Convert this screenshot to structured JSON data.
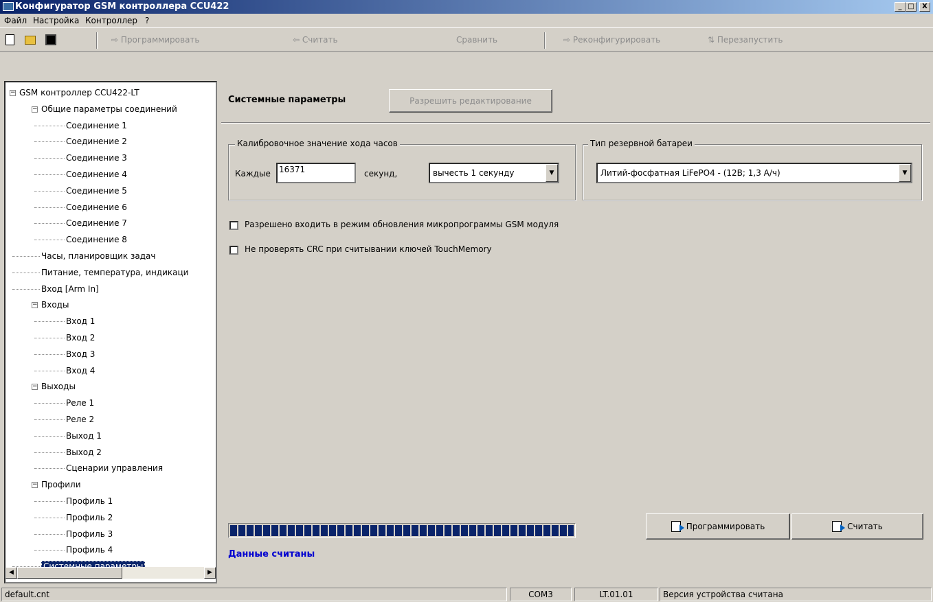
{
  "window": {
    "title": "Конфигуратор GSM контроллера CCU422",
    "icon": "app-icon",
    "minimize": "_",
    "maximize": "□",
    "close": "X"
  },
  "menu": [
    "Файл",
    "Настройка",
    "Контроллер",
    "?"
  ],
  "toolbar": {
    "program": "Программировать",
    "read": "Считать",
    "compare": "Сравнить",
    "reconfigure": "Реконфигурировать",
    "restart": "Перезапустить"
  },
  "tree": [
    {
      "label": "GSM контроллер CCU422-LT",
      "level": 0,
      "expanded": true
    },
    {
      "label": "Общие параметры соединений",
      "level": 1,
      "expanded": true
    },
    {
      "label": "Соединение 1",
      "level": 2
    },
    {
      "label": "Соединение 2",
      "level": 2
    },
    {
      "label": "Соединение 3",
      "level": 2
    },
    {
      "label": "Соединение 4",
      "level": 2
    },
    {
      "label": "Соединение 5",
      "level": 2
    },
    {
      "label": "Соединение 6",
      "level": 2
    },
    {
      "label": "Соединение 7",
      "level": 2
    },
    {
      "label": "Соединение 8",
      "level": 2
    },
    {
      "label": "Часы, планировщик задач",
      "level": 1
    },
    {
      "label": "Питание, температура, индикаци",
      "level": 1
    },
    {
      "label": "Вход [Arm In]",
      "level": 1
    },
    {
      "label": "Входы",
      "level": 1,
      "expanded": true
    },
    {
      "label": "Вход 1",
      "level": 2
    },
    {
      "label": "Вход 2",
      "level": 2
    },
    {
      "label": "Вход 3",
      "level": 2
    },
    {
      "label": "Вход 4",
      "level": 2
    },
    {
      "label": "Выходы",
      "level": 1,
      "expanded": true
    },
    {
      "label": "Реле 1",
      "level": 2
    },
    {
      "label": "Реле 2",
      "level": 2
    },
    {
      "label": "Выход 1",
      "level": 2
    },
    {
      "label": "Выход 2",
      "level": 2
    },
    {
      "label": "Сценарии управления",
      "level": 2
    },
    {
      "label": "Профили",
      "level": 1,
      "expanded": true
    },
    {
      "label": "Профиль 1",
      "level": 2
    },
    {
      "label": "Профиль 2",
      "level": 2
    },
    {
      "label": "Профиль 3",
      "level": 2
    },
    {
      "label": "Профиль 4",
      "level": 2
    },
    {
      "label": "Системные параметры",
      "level": 1,
      "selected": true
    }
  ],
  "panel": {
    "title": "Системные параметры",
    "enable_edit": "Разрешить редактирование",
    "clock_group": {
      "title": "Калибровочное значение хода часов",
      "every_label": "Каждые",
      "value": "16371",
      "unit_label": "секунд,",
      "action": "вычесть 1 секунду"
    },
    "battery_group": {
      "title": "Тип резервной батареи",
      "value": "Литий-фосфатная LiFePO4 - (12В; 1,3 А/ч)"
    },
    "check_fw_update": {
      "label": "Разрешено входить в режим обновления микропрограммы GSM модуля",
      "checked": false
    },
    "check_crc": {
      "label": "Не проверять CRC при считывании ключей TouchMemory",
      "checked": false
    },
    "progress": 1.0,
    "status": "Данные считаны",
    "program_button": "Программировать",
    "read_button": "Считать"
  },
  "statusbar": {
    "file": "default.cnt",
    "port": "COM3",
    "version": "LT.01.01",
    "message": "Версия устройства считана"
  },
  "colors": {
    "selection": "#0a246a",
    "status_text": "#0000d0",
    "face": "#d4d0c8"
  }
}
